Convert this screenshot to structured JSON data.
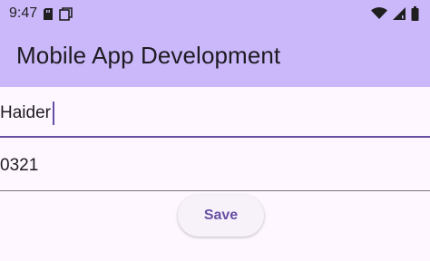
{
  "status_bar": {
    "time": "9:47",
    "left_icons": [
      "sd-card-icon",
      "screen-icon"
    ],
    "right_icons": [
      "wifi-icon",
      "cell-signal-icon",
      "battery-icon"
    ]
  },
  "app_bar": {
    "title": "Mobile App Development",
    "color": "#cbb8fb"
  },
  "form": {
    "name_field": {
      "value": "Haider",
      "focused": true
    },
    "phone_field": {
      "value": "0321"
    },
    "save_label": "Save"
  },
  "colors": {
    "accent": "#6750a4",
    "background": "#fef7ff"
  }
}
